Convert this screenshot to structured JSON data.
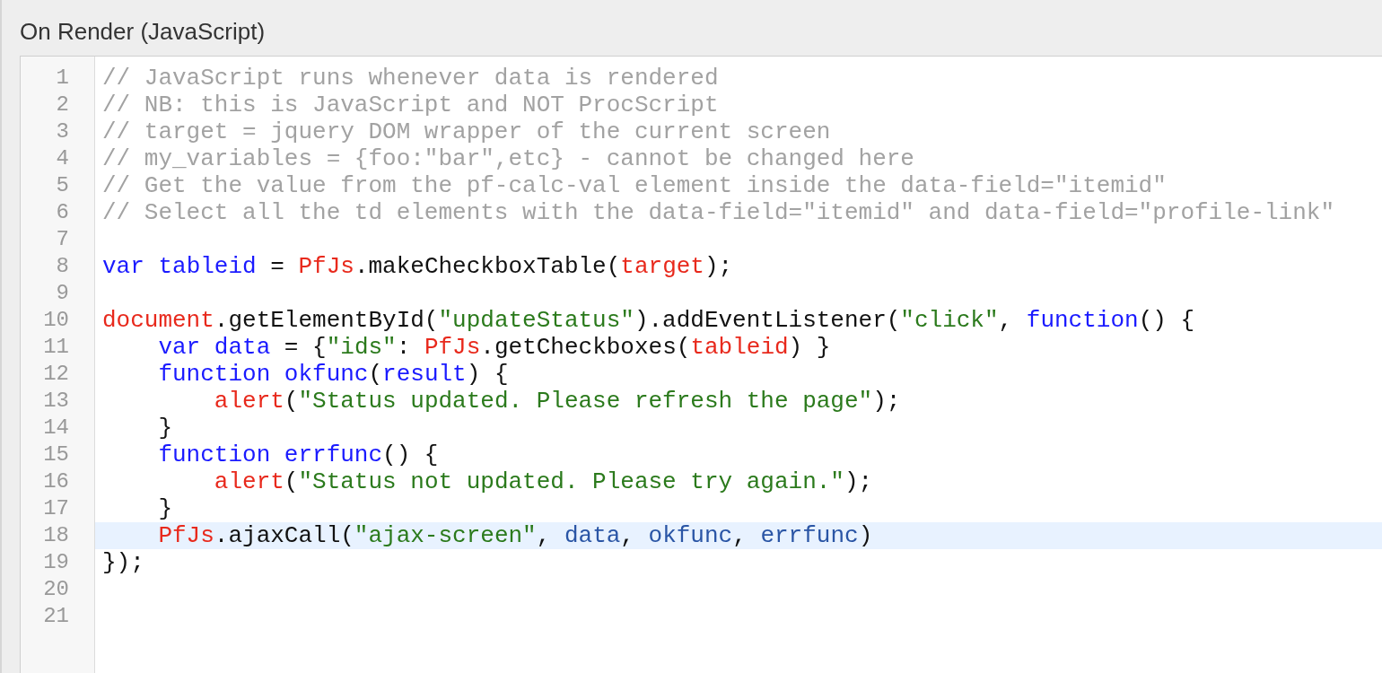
{
  "panel": {
    "title": "On Render (JavaScript)"
  },
  "editor": {
    "lines": [
      {
        "number": "1",
        "active": false,
        "tokens": [
          {
            "text": "// JavaScript runs whenever data is rendered",
            "kind": "comment"
          }
        ]
      },
      {
        "number": "2",
        "active": false,
        "tokens": [
          {
            "text": "// NB: this is JavaScript and NOT ProcScript",
            "kind": "comment"
          }
        ]
      },
      {
        "number": "3",
        "active": false,
        "tokens": [
          {
            "text": "// target = jquery DOM wrapper of the current screen",
            "kind": "comment"
          }
        ]
      },
      {
        "number": "4",
        "active": false,
        "tokens": [
          {
            "text": "// my_variables = {foo:\"bar\",etc} - cannot be changed here",
            "kind": "comment"
          }
        ]
      },
      {
        "number": "5",
        "active": false,
        "tokens": [
          {
            "text": "// Get the value from the pf-calc-val element inside the data-field=\"itemid\"",
            "kind": "comment"
          }
        ]
      },
      {
        "number": "6",
        "active": false,
        "tokens": [
          {
            "text": "// Select all the td elements with the data-field=\"itemid\" and data-field=\"profile-link\"",
            "kind": "comment"
          }
        ]
      },
      {
        "number": "7",
        "active": false
      },
      {
        "number": "8",
        "active": false,
        "tokens": [
          {
            "text": "var ",
            "kind": "keyword"
          },
          {
            "text": "tableid",
            "kind": "def"
          },
          {
            "text": " = ",
            "kind": "plain"
          },
          {
            "text": "PfJs",
            "kind": "builtin"
          },
          {
            "text": ".makeCheckboxTable(",
            "kind": "plain"
          },
          {
            "text": "target",
            "kind": "builtin"
          },
          {
            "text": ");",
            "kind": "plain"
          }
        ]
      },
      {
        "number": "9",
        "active": false
      },
      {
        "number": "10",
        "active": false,
        "tokens": [
          {
            "text": "document",
            "kind": "builtin"
          },
          {
            "text": ".getElementById(",
            "kind": "plain"
          },
          {
            "text": "\"updateStatus\"",
            "kind": "string"
          },
          {
            "text": ").addEventListener(",
            "kind": "plain"
          },
          {
            "text": "\"click\"",
            "kind": "string"
          },
          {
            "text": ", ",
            "kind": "plain"
          },
          {
            "text": "function",
            "kind": "keyword"
          },
          {
            "text": "() {",
            "kind": "plain"
          }
        ]
      },
      {
        "number": "11",
        "active": false,
        "tokens": [
          {
            "text": "    var ",
            "kind": "keyword"
          },
          {
            "text": "data",
            "kind": "def"
          },
          {
            "text": " = {",
            "kind": "plain"
          },
          {
            "text": "\"ids\"",
            "kind": "string"
          },
          {
            "text": ": ",
            "kind": "plain"
          },
          {
            "text": "PfJs",
            "kind": "builtin"
          },
          {
            "text": ".getCheckboxes(",
            "kind": "plain"
          },
          {
            "text": "tableid",
            "kind": "builtin"
          },
          {
            "text": ") }",
            "kind": "plain"
          }
        ]
      },
      {
        "number": "12",
        "active": false,
        "tokens": [
          {
            "text": "    function ",
            "kind": "keyword"
          },
          {
            "text": "okfunc",
            "kind": "def"
          },
          {
            "text": "(",
            "kind": "plain"
          },
          {
            "text": "result",
            "kind": "def"
          },
          {
            "text": ") {",
            "kind": "plain"
          }
        ]
      },
      {
        "number": "13",
        "active": false,
        "tokens": [
          {
            "text": "        alert",
            "kind": "builtin"
          },
          {
            "text": "(",
            "kind": "plain"
          },
          {
            "text": "\"Status updated. Please refresh the page\"",
            "kind": "string"
          },
          {
            "text": ");",
            "kind": "plain"
          }
        ]
      },
      {
        "number": "14",
        "active": false,
        "tokens": [
          {
            "text": "    }",
            "kind": "plain"
          }
        ]
      },
      {
        "number": "15",
        "active": false,
        "tokens": [
          {
            "text": "    function ",
            "kind": "keyword"
          },
          {
            "text": "errfunc",
            "kind": "def"
          },
          {
            "text": "() {",
            "kind": "plain"
          }
        ]
      },
      {
        "number": "16",
        "active": false,
        "tokens": [
          {
            "text": "        alert",
            "kind": "builtin"
          },
          {
            "text": "(",
            "kind": "plain"
          },
          {
            "text": "\"Status not updated. Please try again.\"",
            "kind": "string"
          },
          {
            "text": ");",
            "kind": "plain"
          }
        ]
      },
      {
        "number": "17",
        "active": false,
        "tokens": [
          {
            "text": "    }",
            "kind": "plain"
          }
        ]
      },
      {
        "number": "18",
        "active": true,
        "tokens": [
          {
            "text": "    PfJs",
            "kind": "builtin"
          },
          {
            "text": ".ajaxCall(",
            "kind": "plain"
          },
          {
            "text": "\"ajax-screen\"",
            "kind": "string"
          },
          {
            "text": ", ",
            "kind": "plain"
          },
          {
            "text": "data",
            "kind": "variable"
          },
          {
            "text": ", ",
            "kind": "plain"
          },
          {
            "text": "okfunc",
            "kind": "variable"
          },
          {
            "text": ", ",
            "kind": "plain"
          },
          {
            "text": "errfunc",
            "kind": "variable"
          },
          {
            "text": ")",
            "kind": "plain"
          }
        ]
      },
      {
        "number": "19",
        "active": false,
        "tokens": [
          {
            "text": "});",
            "kind": "plain"
          }
        ]
      },
      {
        "number": "20",
        "active": false
      },
      {
        "number": "21",
        "active": false
      }
    ]
  }
}
